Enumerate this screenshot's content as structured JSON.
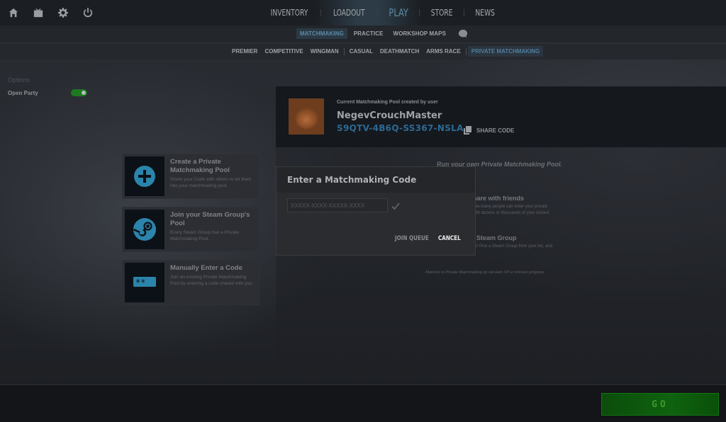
{
  "topbar": {
    "icons": [
      "home-icon",
      "tv-icon",
      "settings-gear-icon",
      "power-icon"
    ],
    "nav": [
      {
        "label": "INVENTORY",
        "active": false
      },
      {
        "label": "LOADOUT",
        "active": false
      },
      {
        "label": "PLAY",
        "active": true
      },
      {
        "label": "STORE",
        "active": false
      },
      {
        "label": "NEWS",
        "active": false
      }
    ]
  },
  "subnav": {
    "items": [
      {
        "label": "MATCHMAKING",
        "active": true
      },
      {
        "label": "PRACTICE",
        "active": false
      },
      {
        "label": "WORKSHOP MAPS",
        "active": false
      }
    ]
  },
  "modes": {
    "items": [
      {
        "label": "PREMIER"
      },
      {
        "label": "COMPETITIVE"
      },
      {
        "label": "WINGMAN"
      },
      {
        "label": "CASUAL"
      },
      {
        "label": "DEATHMATCH"
      },
      {
        "label": "ARMS RACE"
      },
      {
        "label": "PRIVATE MATCHMAKING",
        "active": true
      }
    ]
  },
  "options": {
    "title": "Options",
    "open_party_label": "Open Party",
    "open_party_enabled": true
  },
  "cards": [
    {
      "title": "Create a Private Matchmaking Pool",
      "desc": "Share your Code with others to let them into your matchmaking pool.",
      "icon": "plus-circle-icon"
    },
    {
      "title": "Join your Steam Group's Pool",
      "desc": "Every Steam Group has a Private Matchmaking Pool.",
      "icon": "steam-logo-icon"
    },
    {
      "title": "Manually Enter a Code",
      "desc": "Join an existing Private Matchmaking Pool by entering a code shared with you.",
      "icon": "password-field-icon"
    }
  ],
  "pool": {
    "subtitle": "Current Matchmaking Pool created by user",
    "username": "NegevCrouchMaster",
    "code": "S9QTV-4B6Q-SS367-NSLA",
    "share_label": "SHARE CODE"
  },
  "info": {
    "heading": "Run your own Private Matchmaking Pool.",
    "h1": "aking Code to share with friends",
    "p1": "team! There's no limit to how many people can enter your private\nl free to share your code with dozens or thousands of your closest",
    "h2": "th members of a Steam Group",
    "p2": "y or create one of your own! Pick a Steam Group from your list, and\nroup.",
    "note": "- Matches in Private Matchmaking do not earn XP or mission progress."
  },
  "modal": {
    "title": "Enter a Matchmaking Code",
    "input_value": "",
    "input_placeholder": "XXXXX-XXXX-XXXXX-XXXX",
    "join_label": "JOIN QUEUE",
    "cancel_label": "CANCEL"
  },
  "go_button": {
    "label": "GO"
  },
  "colors": {
    "accent_blue": "#2c6a94",
    "toggle_green": "#1d7a21",
    "go_green": "#0f620f"
  }
}
